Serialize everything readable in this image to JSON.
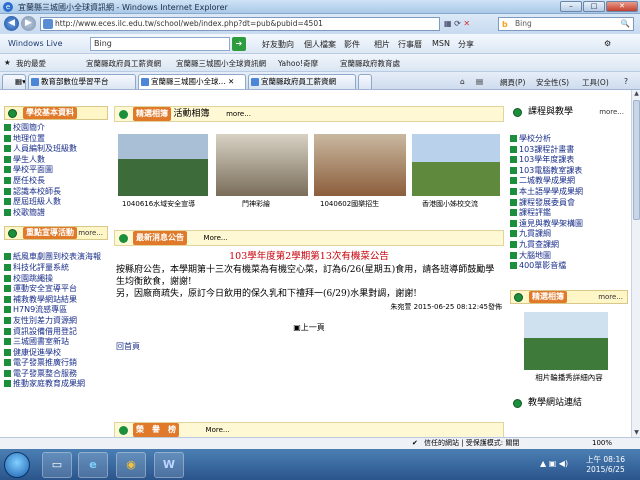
{
  "window": {
    "title": "宜蘭縣三城國小全球資訊網 - Windows Internet Explorer"
  },
  "address": {
    "url": "http://www.eces.ilc.edu.tw/school/web/index.php?dt=pub&pubid=4501",
    "search_placeholder": "Bing"
  },
  "live_bar": {
    "brand": "Windows Live",
    "search_value": "Bing",
    "items": [
      "好友動向",
      "個人檔案",
      "影件",
      "相片",
      "行事曆",
      "MSN",
      "分享"
    ]
  },
  "favorites_bar": {
    "favorites": "我的最愛",
    "items": [
      "宜蘭縣政府員工薪資網",
      "宜蘭縣三城國小全球資訊網",
      "Yahoo!奇摩",
      "宜蘭縣政府教育處"
    ]
  },
  "tabs": {
    "items": [
      "教育部數位學習平台",
      "宜蘭縣三城國小全球...",
      "宜蘭縣政府員工薪資網"
    ],
    "tools": [
      "首頁",
      "網頁(P)",
      "安全性(S)",
      "工具(O)"
    ]
  },
  "left": {
    "school_info": {
      "header": "學校基本資料",
      "items": [
        "校園簡介",
        "地理位置",
        "人員編制及班級數",
        "學生人數",
        "學校平面圖",
        "歷任校長",
        "認識本校師長",
        "歷屆班級人數",
        "校歌簡譜"
      ]
    },
    "promotion": {
      "header": "重點宣導活動",
      "more": "more...",
      "items": [
        "紙風車劇團到校表演海報",
        "科技化評量系統",
        "校園跳繩操",
        "運動安全宣導平台",
        "補救教學網站結果",
        "H7N9流感專區",
        "友性別差力資源網",
        "資訊設備借用登記",
        "三城國書室新站",
        "健康促進學校",
        "電子發票推廣行銷",
        "電子發票整合服務",
        "推動家庭教育成果網"
      ]
    }
  },
  "center": {
    "album": {
      "header": "精選相簿",
      "title": "活動相簿",
      "more": "more...",
      "photos": [
        "1040616水域安全宣導",
        "門神彩繪",
        "1040602國樂招生",
        "香港國小姊校交流"
      ]
    },
    "announcement": {
      "header": "最新消息公告",
      "more": "More...",
      "title": "103學年度第2學期第13次有機菜公告",
      "body_1": "按縣府公告，本學期第十三次有機菜為有機空心菜，訂為6/26(星期五)食用，請各班導師鼓勵學生均衡飲食，謝謝!",
      "body_2": "另，因廠商疏失，原訂今日飲用的保久乳和下禮拜一(6/29)水果對調，謝謝!",
      "meta": "朱宛萱  2015-06-25 08:12:45發佈",
      "prev_page": "上一頁",
      "home": "回首頁"
    },
    "bottom_header": "榮　譽　榜",
    "bottom_more": "More..."
  },
  "right": {
    "curriculum": {
      "header": "課程與教學",
      "more": "more...",
      "items": [
        "學校分析",
        "103課程計畫書",
        "103學年度課表",
        "103電腦教室課表",
        "二城教學成果網",
        "本土語學學成果網",
        "課程發展委員會",
        "課程評鑑",
        "遠見與教學架構圖",
        "九貫課綱",
        "九貫查課網",
        "大腦地圖",
        "400單影音檔"
      ]
    },
    "album": {
      "header": "精選相簿",
      "more": "more...",
      "caption": "相片輪播秀詳細內容"
    },
    "links": {
      "header": "教學網站連結"
    }
  },
  "status": {
    "zone": "信任的網站 | 受保護模式: 關閉",
    "zoom": "100%"
  },
  "taskbar": {
    "time": "上午 08:16",
    "date": "2015/6/25"
  }
}
